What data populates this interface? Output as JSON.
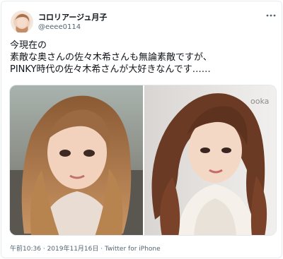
{
  "author": {
    "display_name": "コロリアージュ月子",
    "handle": "@eeee0114",
    "avatar_icon": "profile-avatar"
  },
  "menu": {
    "icon": "more-horizontal-icon"
  },
  "tweet": {
    "lines": [
      "今現在の",
      "素敵な奥さんの佐々木希さんも無論素敵ですが、",
      "PINKY時代の佐々木希さんが大好きなんです……"
    ]
  },
  "media": {
    "photos": [
      {
        "name": "photo-left",
        "description_icon": "portrait-photo"
      },
      {
        "name": "photo-right",
        "description_icon": "portrait-photo"
      }
    ]
  },
  "meta": {
    "time": "午前10:36",
    "sep1": "·",
    "date": "2019年11月16日",
    "sep2": "·",
    "source": "Twitter for iPhone"
  },
  "colors": {
    "text": "#0f1419",
    "secondary": "#536471",
    "border": "#e6ecf0"
  }
}
